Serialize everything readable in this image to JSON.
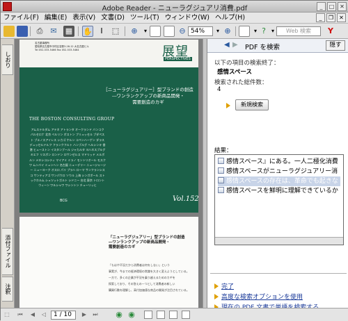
{
  "window": {
    "title": "Adobe Reader - ニューラグジュアリ消費.pdf"
  },
  "menu": {
    "items": [
      "ファイル(F)",
      "編集(E)",
      "表示(V)",
      "文書(D)",
      "ツール(T)",
      "ウィンドウ(W)",
      "ヘルプ(H)"
    ]
  },
  "toolbar": {
    "zoom": "54%",
    "search_placeholder": "Web 検索"
  },
  "lefttabs": {
    "tab1": "しおり",
    "tab2": "添付ファイル",
    "tab3": "注釈"
  },
  "page1": {
    "journal": "展望",
    "journal_sub": "PERSPECTIVES",
    "address_line1": "名古屋事務所",
    "address_line2": "愛知県名古屋市中村区名駅3-28-12 大名古屋ビル",
    "address_line3": "Tel 052-533-5466  Fax 052-533-5464",
    "headline1": "［ニューラグジュアリー］型ブランドの創造",
    "headline2": "―ワンランクアップの新商品開発・",
    "headline3": "需要創造のカギ",
    "bcg": "THE BOSTON CONSULTING GROUP",
    "offices": "アムステルダム アテネ アトランタ オークランド バンコク バルセロナ 北京 ベルリン ボストン ブリュッセル ブダペスト ブエノスアイレス シカゴ ケルン コペンハーゲン ダラス デュッセルドルフ フランクフルト ハンブルグ ヘルシンキ 香港 ヒューストン イスタンブール ジャカルタ ヨハネスブルグ キエフ リスボン ロンドン ロサンゼルス マドリッド メルボルン メキシコシティ マイアミ ミラノ モントリオール モスクワ ムンバイ ミュンヘン 名古屋 ニューデリー ニュージャージー ニューヨーク オスロ パリ プラハ ローマ サンフランシスコ サンティアゴ サンパウロ ソウル 上海 シンガポール ストックホルム シュツットガルト シドニー 台北 東京 トロント ウィーン ワルシャワ ワシントン チューリッヒ",
    "bcg_short": "BCG",
    "vol": "Vol.152"
  },
  "page2": {
    "title1": "「ニューラグジュアリー」型ブランドの創造",
    "title2": "―ワンランクアップの新商品開発・",
    "title3": "需要創造のカギ",
    "body1": "「もはや不況だから消費者は何をしない」という",
    "body2": "事実が、今までの経済環境の常識を大きく変えようとしている。",
    "body3": "一方で、多くの企業が不況を乗り越えるためのカギを",
    "body4": "探索しており、その答えの一つとして消費者の新しい",
    "body5": "購買行動を理解し、高付加価値な商品の開発が注目されている。"
  },
  "panel": {
    "header": "PDF を検索",
    "hide_button": "隠す",
    "complete_label": "以下の項目の検索終了：",
    "query": "感情スペース",
    "count_label": "検索された総件数：",
    "count": "4",
    "new_search_button": "新規検索",
    "results_label": "結果：",
    "results": [
      "感情スペース』にある。一人二極化消費",
      "感情スペースがニューラグジュアリー消",
      "感情スペースの存在は、革命でも起きな",
      "感情スペースを鮮明に理解できているか"
    ],
    "link_done": "完了",
    "link_advanced": "高度な検索オプションを使用",
    "link_web": "現在の PDF 文書で単語を検索する"
  },
  "statusbar": {
    "page": "1 / 10"
  },
  "colors": {
    "cover_green": "#1a6048",
    "link_blue": "#1a3a99",
    "selection": "#c8d4e8",
    "arrow": "#e0a000"
  }
}
